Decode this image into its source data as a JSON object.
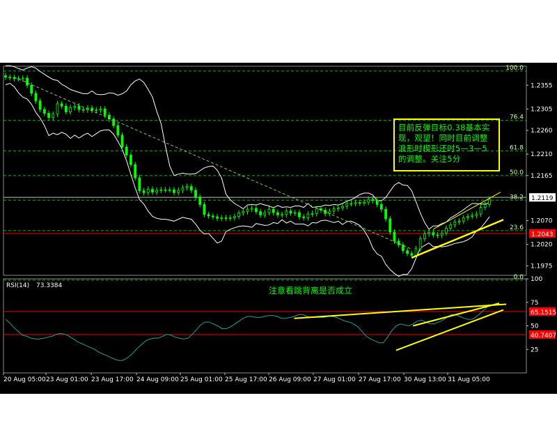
{
  "chart_data": [
    {
      "type": "candlestick",
      "title": "",
      "price_ticks": [
        "1.2355",
        "1.2305",
        "1.2260",
        "1.2210",
        "1.2165",
        "1.2070",
        "1.2020",
        "1.1975"
      ],
      "price_ticks_values": [
        1.2355,
        1.2305,
        1.226,
        1.221,
        1.2165,
        1.207,
        1.202,
        1.1975
      ],
      "ylim": [
        1.1955,
        1.2395
      ],
      "current_price": "1.2119",
      "current_price_value": 1.2119,
      "red_line_label": "1.2043",
      "red_line_value": 1.2043,
      "fibonacci_levels": [
        {
          "label": "100.0",
          "value": 1.2385
        },
        {
          "label": "76.4",
          "value": 1.2281
        },
        {
          "label": "61.8",
          "value": 1.2217
        },
        {
          "label": "50.0",
          "value": 1.2165
        },
        {
          "label": "38.2",
          "value": 1.2113
        },
        {
          "label": "23.6",
          "value": 1.2049
        },
        {
          "label": "0.0",
          "value": 1.1945
        }
      ],
      "annotation": "目前反弹目标0.38基本实现，观望！同时目前调整浪形时楔形还时5—3—5的调整。关注5分",
      "close_series": [
        1.2372,
        1.2371,
        1.2369,
        1.2369,
        1.237,
        1.2355,
        1.2338,
        1.2322,
        1.2304,
        1.2296,
        1.2287,
        1.2294,
        1.2316,
        1.2311,
        1.2299,
        1.2308,
        1.2311,
        1.2304,
        1.2303,
        1.2307,
        1.2302,
        1.2303,
        1.2305,
        1.2292,
        1.2284,
        1.227,
        1.225,
        1.2225,
        1.2208,
        1.2188,
        1.216,
        1.2133,
        1.2129,
        1.2136,
        1.213,
        1.2134,
        1.2135,
        1.2135,
        1.2135,
        1.2129,
        1.2134,
        1.2139,
        1.2142,
        1.2134,
        1.212,
        1.2104,
        1.2083,
        1.208,
        1.2078,
        1.2075,
        1.2076,
        1.2075,
        1.2076,
        1.2079,
        1.2086,
        1.2089,
        1.2094,
        1.2096,
        1.2089,
        1.2082,
        1.2087,
        1.2094,
        1.2087,
        1.2082,
        1.2083,
        1.209,
        1.2086,
        1.2087,
        1.2078,
        1.2076,
        1.2084,
        1.2085,
        1.2095,
        1.2092,
        1.2085,
        1.209,
        1.2095,
        1.2097,
        1.21,
        1.2106,
        1.2106,
        1.2108,
        1.2107,
        1.2109,
        1.2115,
        1.2112,
        1.2104,
        1.2094,
        1.2074,
        1.2046,
        1.2027,
        1.2019,
        1.2007,
        1.2001,
        1.1997,
        1.2011,
        1.2032,
        1.2042,
        1.2045,
        1.204,
        1.2039,
        1.2044,
        1.2054,
        1.2061,
        1.2067,
        1.2069,
        1.2076,
        1.2079,
        1.2081,
        1.2084,
        1.2098,
        1.2104,
        1.2115
      ],
      "bb_upper": [
        1.2396,
        1.2396,
        1.2394,
        1.239,
        1.2387,
        1.2391,
        1.2394,
        1.2391,
        1.2384,
        1.2378,
        1.2372,
        1.2367,
        1.2365,
        1.2357,
        1.2352,
        1.2346,
        1.2343,
        1.234,
        1.2337,
        1.2337,
        1.2343,
        1.2336,
        1.2335,
        1.2336,
        1.2339,
        1.2338,
        1.2334,
        1.2337,
        1.2343,
        1.2356,
        1.2364,
        1.2368,
        1.2361,
        1.2346,
        1.233,
        1.23,
        1.2274,
        1.2227,
        1.2185,
        1.2165,
        1.2168,
        1.217,
        1.2168,
        1.2168,
        1.2169,
        1.2175,
        1.2181,
        1.2184,
        1.2185,
        1.2176,
        1.216,
        1.2126,
        1.2114,
        1.2106,
        1.2101,
        1.2095,
        1.2103,
        1.2104,
        1.2103,
        1.2106,
        1.2103,
        1.2101,
        1.2097,
        1.2102,
        1.2098,
        1.2099,
        1.2098,
        1.2101,
        1.2101,
        1.2098,
        1.2106,
        1.2098,
        1.2099,
        1.21,
        1.2103,
        1.2102,
        1.2104,
        1.2103,
        1.2106,
        1.2111,
        1.2114,
        1.2119,
        1.2125,
        1.2128,
        1.2128,
        1.2124,
        1.2112,
        1.2112,
        1.2119,
        1.2132,
        1.2145,
        1.215,
        1.2145,
        1.2144,
        1.2133,
        1.211,
        1.2086,
        1.2066,
        1.2052,
        1.2059,
        1.2059,
        1.2064,
        1.2067,
        1.2076,
        1.2081,
        1.2087,
        1.2093,
        1.21,
        1.2106,
        1.2106,
        1.2105,
        1.2105,
        1.2108
      ],
      "bb_lower": [
        1.2356,
        1.2359,
        1.2352,
        1.2339,
        1.233,
        1.2326,
        1.2315,
        1.2298,
        1.2286,
        1.227,
        1.2249,
        1.2254,
        1.2251,
        1.2256,
        1.2252,
        1.2243,
        1.225,
        1.2244,
        1.225,
        1.2254,
        1.2247,
        1.2253,
        1.2259,
        1.2261,
        1.2261,
        1.2252,
        1.2237,
        1.222,
        1.2196,
        1.2167,
        1.2139,
        1.2114,
        1.2105,
        1.209,
        1.2079,
        1.2075,
        1.2073,
        1.2073,
        1.2071,
        1.2069,
        1.2073,
        1.2077,
        1.2075,
        1.2073,
        1.2063,
        1.205,
        1.2042,
        1.2043,
        1.2033,
        1.2023,
        1.2027,
        1.2047,
        1.2052,
        1.2055,
        1.2058,
        1.2059,
        1.2058,
        1.2056,
        1.2064,
        1.2062,
        1.206,
        1.2061,
        1.2066,
        1.2064,
        1.2072,
        1.2065,
        1.2069,
        1.2063,
        1.2063,
        1.2063,
        1.2059,
        1.2066,
        1.2065,
        1.207,
        1.2071,
        1.2069,
        1.2066,
        1.2069,
        1.2062,
        1.2068,
        1.2069,
        1.2065,
        1.206,
        1.2049,
        1.2034,
        1.2012,
        1.2,
        1.1995,
        1.1978,
        1.1967,
        1.1959,
        1.1953,
        1.1957,
        1.1957,
        1.1969,
        1.1991,
        1.2012,
        1.2018,
        1.2023,
        1.2015,
        1.2016,
        1.2015,
        1.2016,
        1.2019,
        1.2022,
        1.2024,
        1.2026,
        1.203,
        1.2036,
        1.2049,
        1.2055,
        1.2066,
        1.2078
      ]
    },
    {
      "type": "line",
      "title": "RSI(14)",
      "value_label": "73.3384",
      "ylim": [
        0,
        100
      ],
      "y_ticks": [
        100,
        75,
        50,
        25
      ],
      "overbought_label": "65.1515",
      "overbought_value": 65.1515,
      "oversold_label": "40.7407",
      "oversold_value": 40.7407,
      "annotation": "注意看跳背离是否成立",
      "values": [
        57,
        53,
        48,
        44,
        40,
        39,
        37,
        36,
        36,
        37,
        38,
        39,
        41,
        42,
        41,
        39,
        36,
        33,
        31,
        29,
        27,
        25,
        22,
        20,
        18,
        16,
        14,
        13,
        14,
        17,
        21,
        26,
        30,
        34,
        36,
        37,
        37,
        39,
        41,
        40,
        38,
        37,
        36,
        37,
        41,
        46,
        51,
        54,
        54,
        52,
        50,
        47,
        47,
        49,
        52,
        55,
        58,
        60,
        60,
        59,
        59,
        60,
        61,
        61,
        60,
        58,
        58,
        59,
        60,
        62,
        62,
        60,
        59,
        59,
        59,
        59,
        60,
        60,
        59,
        57,
        55,
        54,
        52,
        49,
        44,
        39,
        36,
        34,
        32,
        32,
        38,
        45,
        50,
        52,
        51,
        50,
        52,
        55,
        56,
        54,
        52,
        52,
        54,
        56,
        59,
        62,
        62,
        60,
        58,
        57,
        57,
        60,
        64,
        68,
        73
      ],
      "x_ticks": [
        "20 Aug 05:00",
        "23 Aug 01:00",
        "23 Aug 17:00",
        "24 Aug 09:00",
        "25 Aug 01:00",
        "25 Aug 17:00",
        "26 Aug 09:00",
        "27 Aug 01:00",
        "27 Aug 17:00",
        "30 Aug 13:00",
        "31 Aug 05:00"
      ]
    }
  ]
}
